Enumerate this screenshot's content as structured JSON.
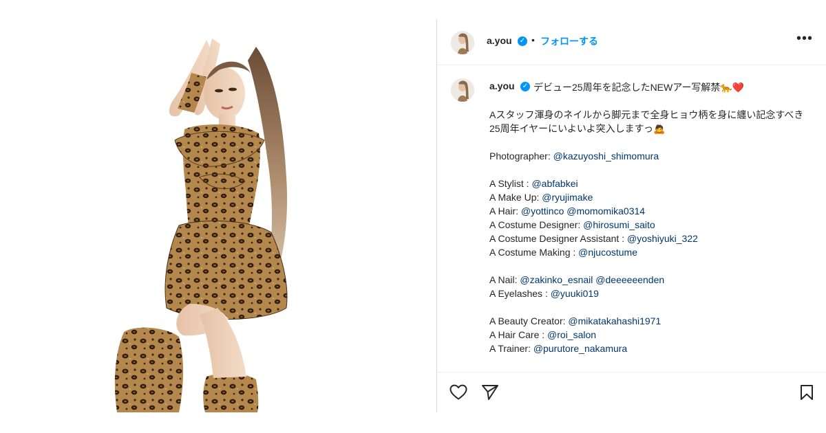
{
  "post": {
    "username": "a.you",
    "verified_icon": "verified-badge-icon",
    "separator": "•",
    "follow_label": "フォローする",
    "more_icon": "more-options-icon",
    "more_label": "•••",
    "accent_color": "#0095f6",
    "mention_color": "#00376b"
  },
  "caption": {
    "username": "a.you",
    "title": "デビュー25周年を記念したNEWアー写解禁🐆❤️",
    "body_line1": "Aスタッフ渾身のネイルから脚元まで全身ヒョウ柄を身に纏い記念すべき25周年イヤーにいよいよ突入しますっ🙇",
    "credits_group1": [
      {
        "role": "Photographer: ",
        "mention": "@kazuyoshi_shimomura"
      }
    ],
    "credits_group2": [
      {
        "role": "A Stylist : ",
        "mention": "@abfabkei",
        "extra": ""
      },
      {
        "role": "A Make Up: ",
        "mention": "@ryujimake",
        "extra": ""
      },
      {
        "role": "A Hair: ",
        "mention": "@yottinco",
        "extra": "@momomika0314"
      },
      {
        "role": "A Costume Designer: ",
        "mention": "@hirosumi_saito",
        "extra": ""
      },
      {
        "role": "A Costume Designer Assistant : ",
        "mention": "@yoshiyuki_322",
        "extra": ""
      },
      {
        "role": "A Costume Making : ",
        "mention": "@njucostume",
        "extra": ""
      }
    ],
    "credits_group3": [
      {
        "role": "A Nail: ",
        "mention": "@zakinko_esnail",
        "extra": "@deeeeeenden"
      },
      {
        "role": "A Eyelashes : ",
        "mention": "@yuuki019",
        "extra": ""
      }
    ],
    "credits_group4": [
      {
        "role": "A Beauty Creator: ",
        "mention": "@mikatakahashi1971"
      },
      {
        "role": "A Hair Care : ",
        "mention": "@roi_salon"
      },
      {
        "role": "A Trainer: ",
        "mention": "@purutore_nakamura"
      }
    ]
  },
  "actions": {
    "like_icon": "heart-icon",
    "share_icon": "send-icon",
    "save_icon": "bookmark-icon"
  },
  "photo": {
    "subject": "woman-in-leopard-print-dress",
    "background_color": "#ffffff"
  }
}
